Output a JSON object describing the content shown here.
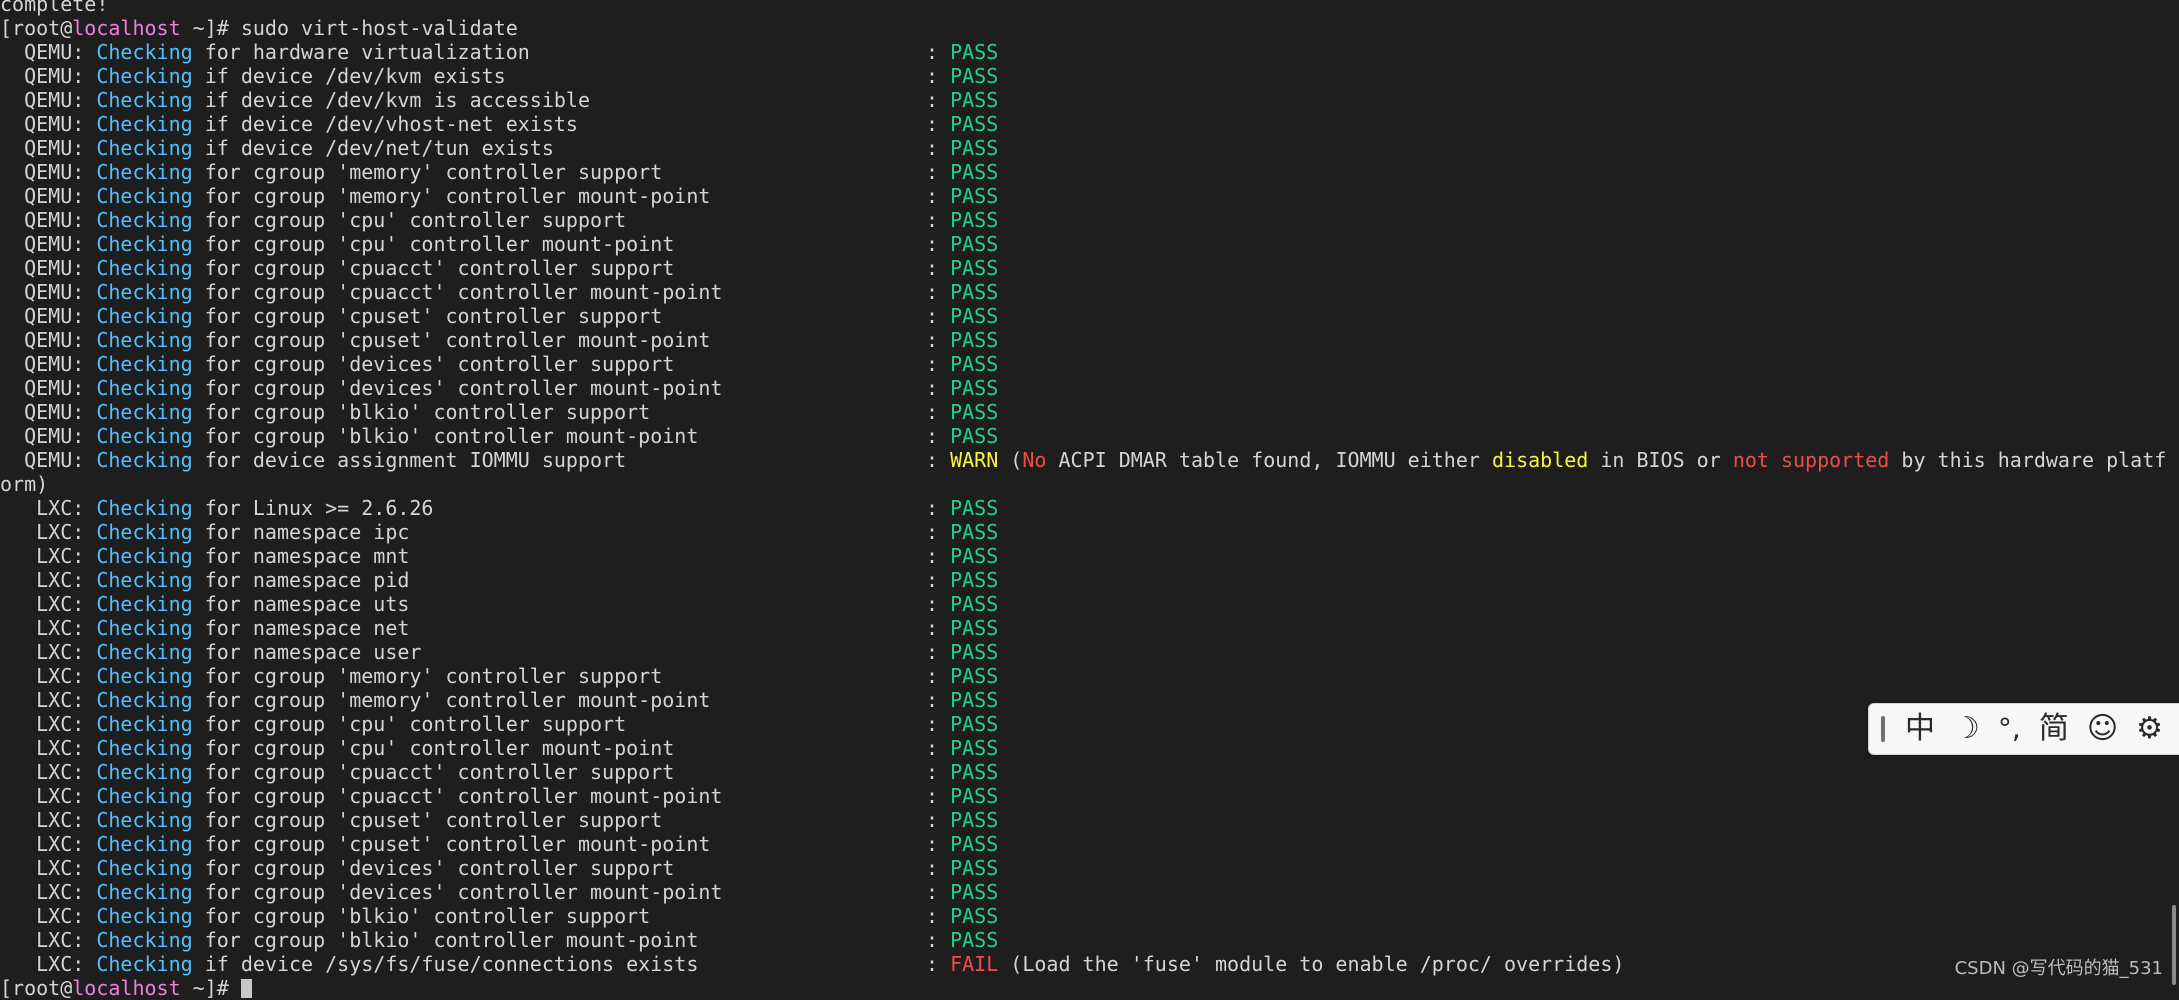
{
  "terminal": {
    "top_partial": "complete!",
    "prompt": {
      "user_prefix": "[root@",
      "host": "localhost",
      "suffix": " ~]# ",
      "command": "sudo virt-host-validate"
    },
    "qemu_checks": [
      {
        "prefix": "  QEMU: ",
        "verb": "Checking",
        "desc": " for hardware virtualization",
        "result": "PASS"
      },
      {
        "prefix": "  QEMU: ",
        "verb": "Checking",
        "desc": " if device /dev/kvm exists",
        "result": "PASS"
      },
      {
        "prefix": "  QEMU: ",
        "verb": "Checking",
        "desc": " if device /dev/kvm is accessible",
        "result": "PASS"
      },
      {
        "prefix": "  QEMU: ",
        "verb": "Checking",
        "desc": " if device /dev/vhost-net exists",
        "result": "PASS"
      },
      {
        "prefix": "  QEMU: ",
        "verb": "Checking",
        "desc": " if device /dev/net/tun exists",
        "result": "PASS"
      },
      {
        "prefix": "  QEMU: ",
        "verb": "Checking",
        "desc": " for cgroup 'memory' controller support",
        "result": "PASS"
      },
      {
        "prefix": "  QEMU: ",
        "verb": "Checking",
        "desc": " for cgroup 'memory' controller mount-point",
        "result": "PASS"
      },
      {
        "prefix": "  QEMU: ",
        "verb": "Checking",
        "desc": " for cgroup 'cpu' controller support",
        "result": "PASS"
      },
      {
        "prefix": "  QEMU: ",
        "verb": "Checking",
        "desc": " for cgroup 'cpu' controller mount-point",
        "result": "PASS"
      },
      {
        "prefix": "  QEMU: ",
        "verb": "Checking",
        "desc": " for cgroup 'cpuacct' controller support",
        "result": "PASS"
      },
      {
        "prefix": "  QEMU: ",
        "verb": "Checking",
        "desc": " for cgroup 'cpuacct' controller mount-point",
        "result": "PASS"
      },
      {
        "prefix": "  QEMU: ",
        "verb": "Checking",
        "desc": " for cgroup 'cpuset' controller support",
        "result": "PASS"
      },
      {
        "prefix": "  QEMU: ",
        "verb": "Checking",
        "desc": " for cgroup 'cpuset' controller mount-point",
        "result": "PASS"
      },
      {
        "prefix": "  QEMU: ",
        "verb": "Checking",
        "desc": " for cgroup 'devices' controller support",
        "result": "PASS"
      },
      {
        "prefix": "  QEMU: ",
        "verb": "Checking",
        "desc": " for cgroup 'devices' controller mount-point",
        "result": "PASS"
      },
      {
        "prefix": "  QEMU: ",
        "verb": "Checking",
        "desc": " for cgroup 'blkio' controller support",
        "result": "PASS"
      },
      {
        "prefix": "  QEMU: ",
        "verb": "Checking",
        "desc": " for cgroup 'blkio' controller mount-point",
        "result": "PASS"
      }
    ],
    "iommu_check": {
      "prefix": "  QEMU: ",
      "verb": "Checking",
      "desc": " for device assignment IOMMU support",
      "result": "WARN",
      "msg_open": " (",
      "msg_no": "No",
      "msg_mid1": " ACPI DMAR table found, IOMMU either ",
      "msg_disabled": "disabled",
      "msg_mid2": " in BIOS or ",
      "msg_not_supported": "not supported",
      "msg_mid3": " by this hardware platf",
      "wrap": "orm)"
    },
    "lxc_checks": [
      {
        "prefix": "   LXC: ",
        "verb": "Checking",
        "desc": " for Linux >= 2.6.26",
        "result": "PASS"
      },
      {
        "prefix": "   LXC: ",
        "verb": "Checking",
        "desc": " for namespace ipc",
        "result": "PASS"
      },
      {
        "prefix": "   LXC: ",
        "verb": "Checking",
        "desc": " for namespace mnt",
        "result": "PASS"
      },
      {
        "prefix": "   LXC: ",
        "verb": "Checking",
        "desc": " for namespace pid",
        "result": "PASS"
      },
      {
        "prefix": "   LXC: ",
        "verb": "Checking",
        "desc": " for namespace uts",
        "result": "PASS"
      },
      {
        "prefix": "   LXC: ",
        "verb": "Checking",
        "desc": " for namespace net",
        "result": "PASS"
      },
      {
        "prefix": "   LXC: ",
        "verb": "Checking",
        "desc": " for namespace user",
        "result": "PASS"
      },
      {
        "prefix": "   LXC: ",
        "verb": "Checking",
        "desc": " for cgroup 'memory' controller support",
        "result": "PASS"
      },
      {
        "prefix": "   LXC: ",
        "verb": "Checking",
        "desc": " for cgroup 'memory' controller mount-point",
        "result": "PASS"
      },
      {
        "prefix": "   LXC: ",
        "verb": "Checking",
        "desc": " for cgroup 'cpu' controller support",
        "result": "PASS"
      },
      {
        "prefix": "   LXC: ",
        "verb": "Checking",
        "desc": " for cgroup 'cpu' controller mount-point",
        "result": "PASS"
      },
      {
        "prefix": "   LXC: ",
        "verb": "Checking",
        "desc": " for cgroup 'cpuacct' controller support",
        "result": "PASS"
      },
      {
        "prefix": "   LXC: ",
        "verb": "Checking",
        "desc": " for cgroup 'cpuacct' controller mount-point",
        "result": "PASS"
      },
      {
        "prefix": "   LXC: ",
        "verb": "Checking",
        "desc": " for cgroup 'cpuset' controller support",
        "result": "PASS"
      },
      {
        "prefix": "   LXC: ",
        "verb": "Checking",
        "desc": " for cgroup 'cpuset' controller mount-point",
        "result": "PASS"
      },
      {
        "prefix": "   LXC: ",
        "verb": "Checking",
        "desc": " for cgroup 'devices' controller support",
        "result": "PASS"
      },
      {
        "prefix": "   LXC: ",
        "verb": "Checking",
        "desc": " for cgroup 'devices' controller mount-point",
        "result": "PASS"
      },
      {
        "prefix": "   LXC: ",
        "verb": "Checking",
        "desc": " for cgroup 'blkio' controller support",
        "result": "PASS"
      },
      {
        "prefix": "   LXC: ",
        "verb": "Checking",
        "desc": " for cgroup 'blkio' controller mount-point",
        "result": "PASS"
      }
    ],
    "fuse_check": {
      "prefix": "   LXC: ",
      "verb": "Checking",
      "desc": " if device /sys/fs/fuse/connections exists",
      "result": "FAIL",
      "msg": " (Load the 'fuse' module to enable /proc/ overrides)"
    },
    "separator": ": ",
    "final_prompt": {
      "user_prefix": "[root@",
      "host": "localhost",
      "suffix": " ~]# "
    }
  },
  "ime_toolbar": {
    "mode_label": "中",
    "moon_label": "☽",
    "punct_label": "°,",
    "simplified_label": "简",
    "emoji_label": "☺",
    "settings_label": "⚙"
  },
  "watermark": "CSDN @写代码的猫_531",
  "colors": {
    "background": "#1e1e1e",
    "text": "#d4d4d4",
    "host": "#f07de0",
    "checking": "#4fc1ff",
    "pass": "#23d18b",
    "warn": "#f5f543",
    "fail": "#f14c4c"
  }
}
